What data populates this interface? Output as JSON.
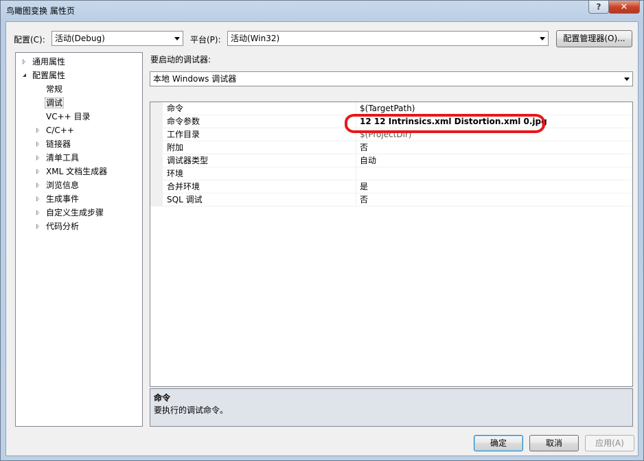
{
  "window": {
    "title": "鸟瞰图变换 属性页",
    "help_glyph": "?",
    "close_glyph": "✕"
  },
  "toolbar": {
    "config_label": "配置(C):",
    "config_value": "活动(Debug)",
    "platform_label": "平台(P):",
    "platform_value": "活动(Win32)",
    "config_manager_label": "配置管理器(O)..."
  },
  "tree": {
    "items": [
      {
        "label": "通用属性",
        "expander": "closed",
        "level": 0
      },
      {
        "label": "配置属性",
        "expander": "open",
        "level": 0
      },
      {
        "label": "常规",
        "expander": "none",
        "level": 1
      },
      {
        "label": "调试",
        "expander": "none",
        "level": 1,
        "selected": true
      },
      {
        "label": "VC++ 目录",
        "expander": "none",
        "level": 1
      },
      {
        "label": "C/C++",
        "expander": "closed",
        "level": 1
      },
      {
        "label": "链接器",
        "expander": "closed",
        "level": 1
      },
      {
        "label": "清单工具",
        "expander": "closed",
        "level": 1
      },
      {
        "label": "XML 文档生成器",
        "expander": "closed",
        "level": 1
      },
      {
        "label": "浏览信息",
        "expander": "closed",
        "level": 1
      },
      {
        "label": "生成事件",
        "expander": "closed",
        "level": 1
      },
      {
        "label": "自定义生成步骤",
        "expander": "closed",
        "level": 1
      },
      {
        "label": "代码分析",
        "expander": "closed",
        "level": 1
      }
    ]
  },
  "debugger": {
    "label": "要启动的调试器:",
    "value": "本地 Windows 调试器"
  },
  "properties": {
    "rows": [
      {
        "name": "命令",
        "value": "$(TargetPath)"
      },
      {
        "name": "命令参数",
        "value": "12 12 Intrinsics.xml Distortion.xml 0.jpg",
        "bold": true
      },
      {
        "name": "工作目录",
        "value": "$(ProjectDir)",
        "faded": true
      },
      {
        "name": "附加",
        "value": "否"
      },
      {
        "name": "调试器类型",
        "value": "自动"
      },
      {
        "name": "环境",
        "value": ""
      },
      {
        "name": "合并环境",
        "value": "是"
      },
      {
        "name": "SQL 调试",
        "value": "否"
      }
    ]
  },
  "description": {
    "title": "命令",
    "text": "要执行的调试命令。"
  },
  "buttons": {
    "ok": "确定",
    "cancel": "取消",
    "apply": "应用(A)"
  },
  "colors": {
    "annotation_circle": "#e8171c",
    "frame": "#b9cde4"
  }
}
